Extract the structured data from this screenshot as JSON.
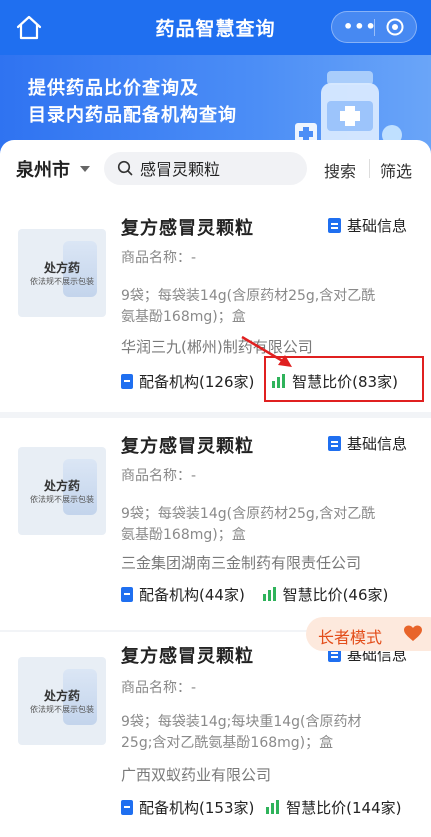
{
  "header": {
    "title": "药品智慧查询",
    "capsule_dots": "•••"
  },
  "banner": {
    "line1": "提供药品比价查询及",
    "line2": "目录内药品配备机构查询"
  },
  "search": {
    "city": "泉州市",
    "value": "感冒灵颗粒",
    "search_label": "搜索",
    "filter_label": "筛选"
  },
  "placeholder_image": {
    "rx_label": "处方药",
    "rx_note": "依法规不展示包装"
  },
  "products": [
    {
      "name": "复方感冒灵颗粒",
      "basic_info": "基础信息",
      "product_name": "商品名称：-",
      "spec_line1": "9袋；每袋装14g(含原药材25g,含对乙酰",
      "spec_line2": "氨基酚168mg)；盒",
      "manufacturer": "华润三九(郴州)制药有限公司",
      "institutions": "配备机构(126家)",
      "price_compare": "智慧比价(83家)"
    },
    {
      "name": "复方感冒灵颗粒",
      "basic_info": "基础信息",
      "product_name": "商品名称：-",
      "spec_line1": "9袋；每袋装14g(含原药材25g,含对乙酰",
      "spec_line2": "氨基酚168mg)；盒",
      "manufacturer": "三金集团湖南三金制药有限责任公司",
      "institutions": "配备机构(44家)",
      "price_compare": "智慧比价(46家)"
    },
    {
      "name": "复方感冒灵颗粒",
      "basic_info": "基础信息",
      "product_name": "商品名称：-",
      "spec_line1": "9袋；每袋装14g;每块重14g(含原药材",
      "spec_line2": "25g;含对乙酰氨基酚168mg)；盒",
      "manufacturer": "广西双蚁药业有限公司",
      "institutions": "配备机构(153家)",
      "price_compare": "智慧比价(144家)"
    }
  ],
  "elder_mode": {
    "label": "长者模式"
  },
  "colors": {
    "primary": "#1f6ff0",
    "highlight": "#e02020",
    "elder_bg": "#fde9dd",
    "elder_text": "#e34d1a",
    "chart_green": "#2fb35b"
  }
}
